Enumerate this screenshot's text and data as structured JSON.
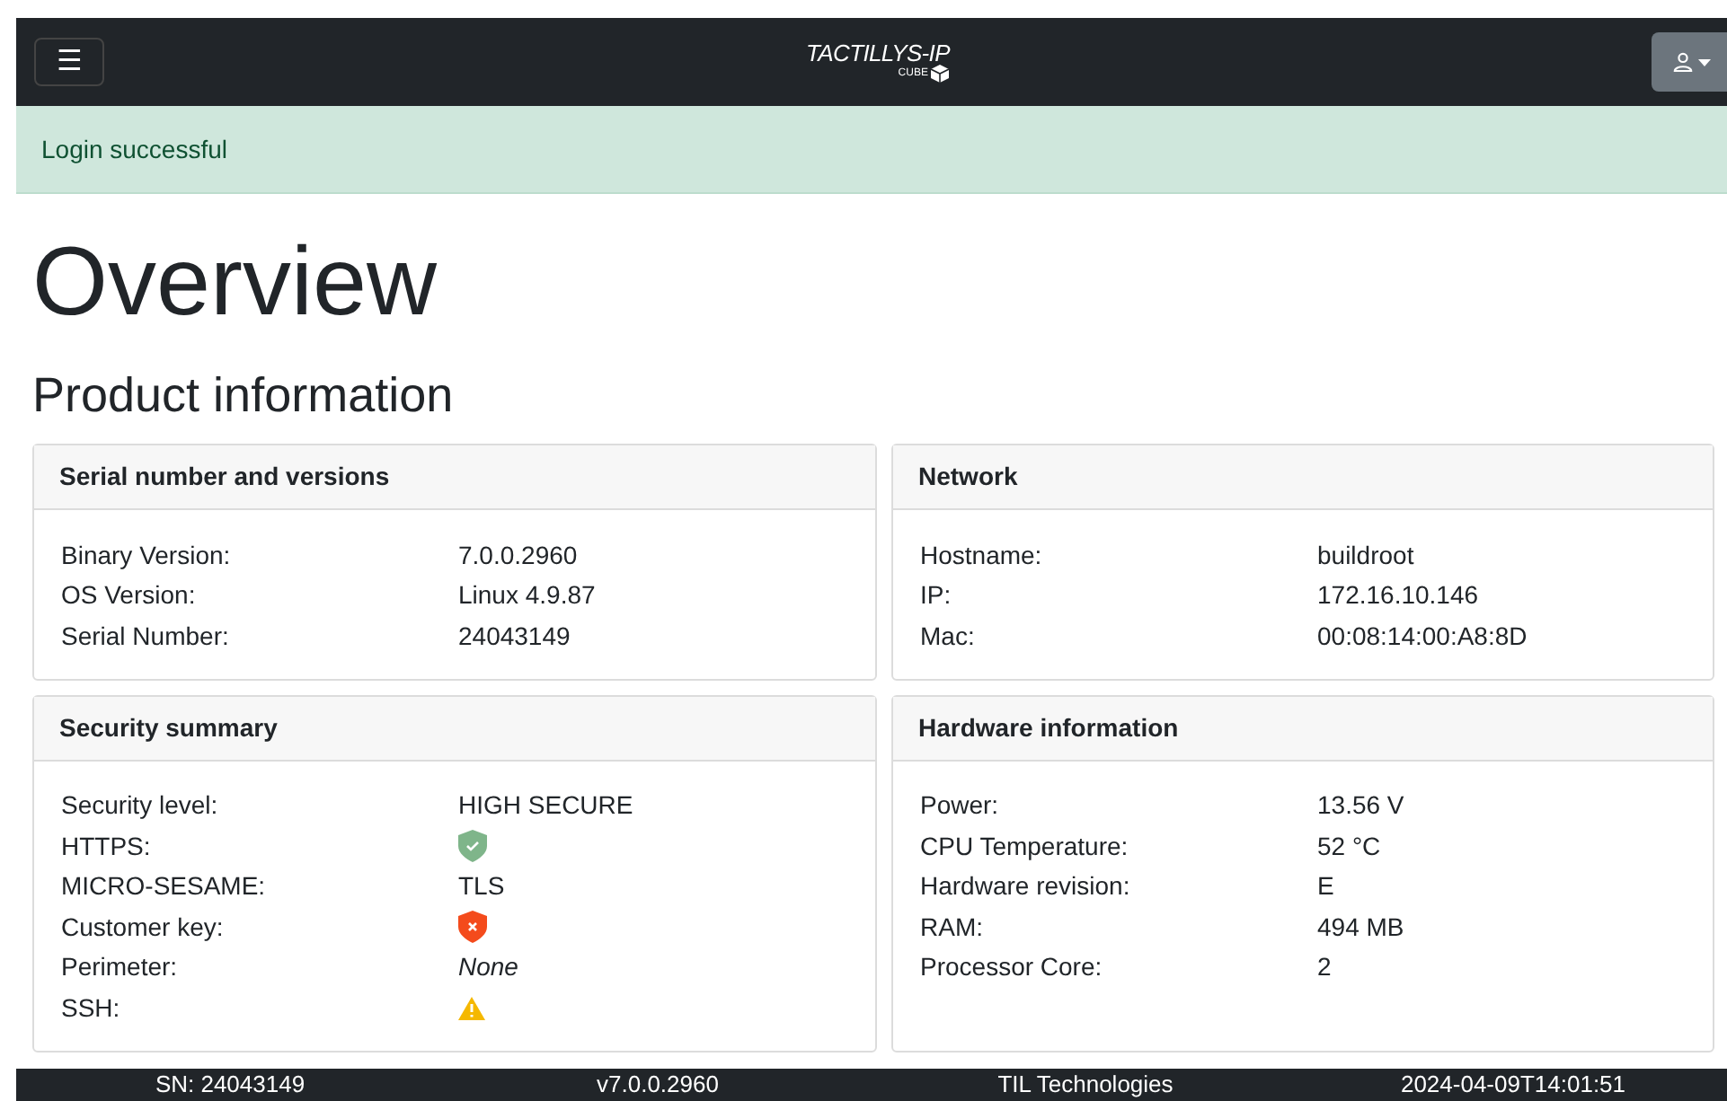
{
  "navbar": {
    "menu_icon": "☰",
    "logo": {
      "title": "TACTILLYS-IP",
      "subtitle": "CUBE"
    }
  },
  "alert": {
    "text": "Login successful"
  },
  "title": "Overview",
  "subtitle": "Product information",
  "cards": [
    {
      "title": "Serial number and versions",
      "rows": [
        {
          "label": "Binary Version:",
          "kind": "text",
          "value": "7.0.0.2960"
        },
        {
          "label": "OS Version:",
          "kind": "text",
          "value": "Linux 4.9.87"
        },
        {
          "label": "Serial Number:",
          "kind": "text",
          "value": "24043149"
        }
      ]
    },
    {
      "title": "Network",
      "rows": [
        {
          "label": "Hostname:",
          "kind": "text",
          "value": "buildroot"
        },
        {
          "label": "IP:",
          "kind": "text",
          "value": "172.16.10.146"
        },
        {
          "label": "Mac:",
          "kind": "text",
          "value": "00:08:14:00:A8:8D"
        }
      ]
    },
    {
      "title": "Security summary",
      "rows": [
        {
          "label": "Security level:",
          "kind": "text",
          "value": "HIGH SECURE"
        },
        {
          "label": "HTTPS:",
          "kind": "ok"
        },
        {
          "label": "MICRO-SESAME:",
          "kind": "text",
          "value": "TLS"
        },
        {
          "label": "Customer key:",
          "kind": "error"
        },
        {
          "label": "Perimeter:",
          "kind": "italic",
          "value": "None"
        },
        {
          "label": "SSH:",
          "kind": "warning"
        }
      ]
    },
    {
      "title": "Hardware information",
      "rows": [
        {
          "label": "Power:",
          "kind": "text",
          "value": "13.56 V"
        },
        {
          "label": "CPU Temperature:",
          "kind": "text",
          "value": "52 °C"
        },
        {
          "label": "Hardware revision:",
          "kind": "text",
          "value": "E"
        },
        {
          "label": "RAM:",
          "kind": "text",
          "value": "494 MB"
        },
        {
          "label": "Processor Core:",
          "kind": "text",
          "value": "2"
        }
      ]
    }
  ],
  "footer": [
    "SN: 24043149",
    "v7.0.0.2960",
    "TIL Technologies",
    "2024-04-09T14:01:51"
  ]
}
